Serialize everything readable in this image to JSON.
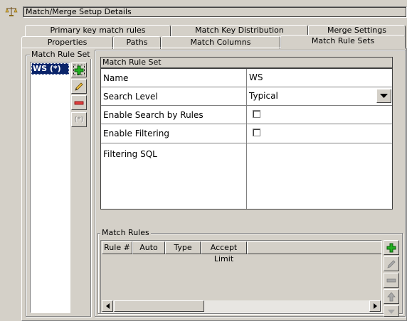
{
  "header": {
    "title": "Match/Merge Setup Details",
    "icon": "scales-icon"
  },
  "tabs": {
    "row1": [
      {
        "label": "Primary key match rules"
      },
      {
        "label": "Match Key Distribution"
      },
      {
        "label": "Merge Settings"
      }
    ],
    "row2": [
      {
        "label": "Properties"
      },
      {
        "label": "Paths"
      },
      {
        "label": "Match Columns"
      },
      {
        "label": "Match Rule Sets",
        "active": true
      }
    ]
  },
  "rule_set_panel": {
    "title": "Match Rule Set",
    "items": [
      {
        "label": "WS (*)",
        "selected": true
      }
    ],
    "buttons": [
      {
        "name": "add",
        "icon": "plus-icon"
      },
      {
        "name": "edit",
        "icon": "pencil-icon"
      },
      {
        "name": "delete",
        "icon": "minus-icon"
      },
      {
        "name": "set-default",
        "icon": "asterisk-icon",
        "label": "(*)"
      }
    ]
  },
  "properties": {
    "header": "Match Rule Set",
    "rows": [
      {
        "name": "Name",
        "value": "WS"
      },
      {
        "name": "Search Level",
        "value": "Typical"
      },
      {
        "name": "Enable Search by Rules",
        "checked": false
      },
      {
        "name": "Enable Filtering",
        "checked": false
      },
      {
        "name": "Filtering SQL",
        "value": ""
      }
    ]
  },
  "match_rules": {
    "title": "Match Rules",
    "columns": [
      "Rule #",
      "Auto",
      "Type",
      "Accept Limit"
    ],
    "rows": [],
    "buttons": [
      "plus-icon",
      "pencil-icon",
      "minus-icon",
      "up-arrow-icon"
    ]
  },
  "colors": {
    "face": "#d4d0c8",
    "selection": "#0a246a",
    "add_green": "#1a9a1a",
    "delete_red": "#c0392b"
  }
}
